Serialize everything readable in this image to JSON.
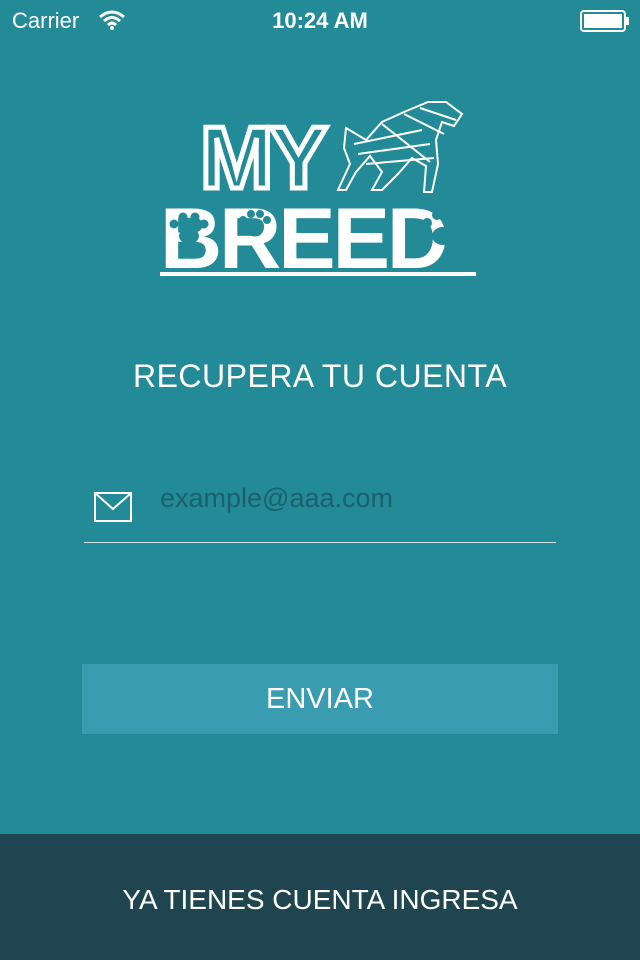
{
  "status_bar": {
    "carrier": "Carrier",
    "time": "10:24 AM"
  },
  "logo": {
    "line1": "MY",
    "line2": "BREED"
  },
  "title": "RECUPERA TU CUENTA",
  "email": {
    "placeholder": "example@aaa.com",
    "value": ""
  },
  "send_button": "ENVIAR",
  "footer": {
    "login_link": "YA TIENES CUENTA INGRESA"
  },
  "colors": {
    "background": "#238a98",
    "button": "#3a9cb0",
    "footer": "#1f4650",
    "placeholder": "#1d5f6c"
  }
}
